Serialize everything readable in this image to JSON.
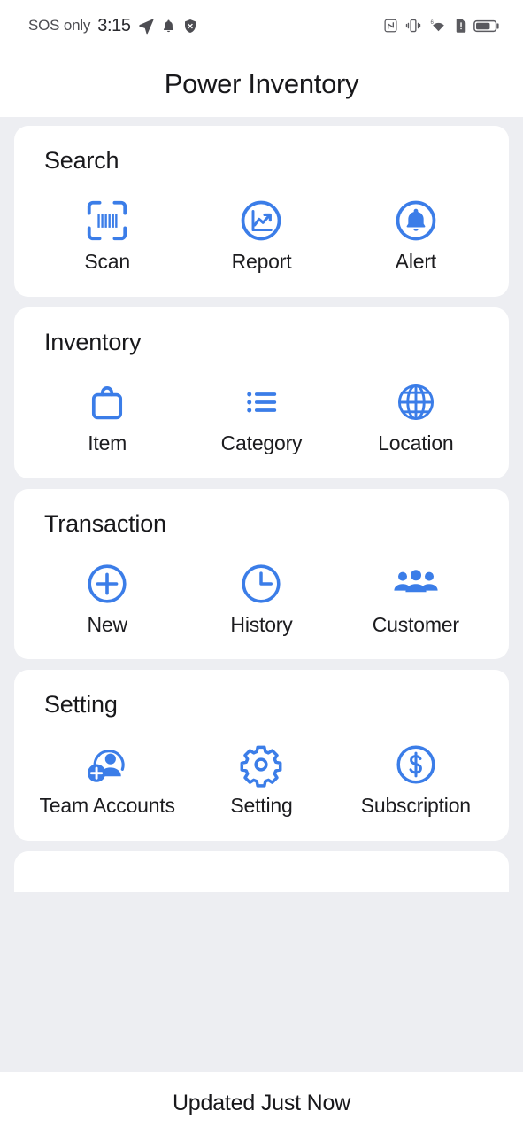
{
  "status_bar": {
    "carrier": "SOS only",
    "time": "3:15",
    "left_icons": [
      "send-icon",
      "bell-icon",
      "shield-off-icon"
    ],
    "right_icons": [
      "nfc-icon",
      "vibrate-icon",
      "wifi-6g-icon",
      "sim-alert-icon",
      "battery-icon"
    ]
  },
  "header": {
    "title": "Power Inventory"
  },
  "theme": {
    "accent": "#3b7de8",
    "background": "#edeef2",
    "card": "#ffffff",
    "text": "#18181b"
  },
  "sections": [
    {
      "title": "Search",
      "tiles": [
        {
          "label": "Scan",
          "icon": "barcode-scan-icon"
        },
        {
          "label": "Report",
          "icon": "chart-circle-icon"
        },
        {
          "label": "Alert",
          "icon": "bell-circle-icon"
        }
      ]
    },
    {
      "title": "Inventory",
      "tiles": [
        {
          "label": "Item",
          "icon": "bag-icon"
        },
        {
          "label": "Category",
          "icon": "list-icon"
        },
        {
          "label": "Location",
          "icon": "globe-icon"
        }
      ]
    },
    {
      "title": "Transaction",
      "tiles": [
        {
          "label": "New",
          "icon": "plus-circle-icon"
        },
        {
          "label": "History",
          "icon": "clock-icon"
        },
        {
          "label": "Customer",
          "icon": "people-group-icon"
        }
      ]
    },
    {
      "title": "Setting",
      "tiles": [
        {
          "label": "Team Accounts",
          "icon": "person-add-icon"
        },
        {
          "label": "Setting",
          "icon": "gear-icon"
        },
        {
          "label": "Subscription",
          "icon": "dollar-circle-icon"
        }
      ]
    }
  ],
  "footer": {
    "status_text": "Updated Just Now"
  }
}
